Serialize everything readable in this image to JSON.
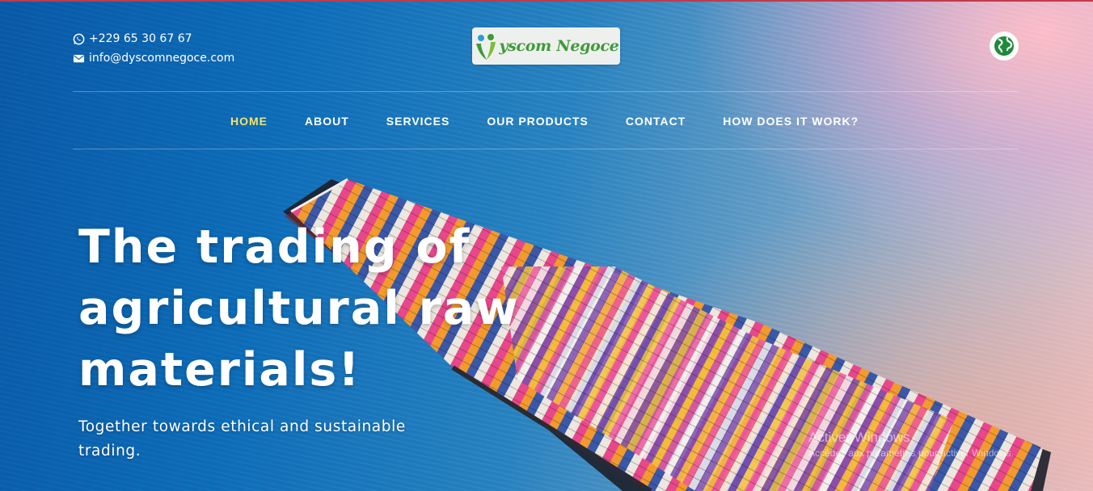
{
  "contact": {
    "phone": "+229 65 30 67 67",
    "email": "info@dyscomnegoce.com",
    "phone_icon": "whatsapp-icon",
    "email_icon": "envelope-icon"
  },
  "logo": {
    "text": "yscom Negoce",
    "brand_color": "#3f9a3a"
  },
  "language_button": {
    "icon": "globe-icon"
  },
  "nav": {
    "items": [
      {
        "label": "HOME",
        "active": true
      },
      {
        "label": "ABOUT",
        "active": false
      },
      {
        "label": "SERVICES",
        "active": false
      },
      {
        "label": "OUR PRODUCTS",
        "active": false
      },
      {
        "label": "CONTACT",
        "active": false
      },
      {
        "label": "HOW DOES IT WORK?",
        "active": false
      }
    ],
    "active_color": "#f5e36a"
  },
  "hero": {
    "headline": "The trading of agricultural raw materials!",
    "subheadline": "Together towards ethical and sustainable trading.",
    "image": "container-ship-at-sea"
  },
  "watermark": {
    "title": "Activer Windows",
    "subtitle": "Accédez aux paramètres pour activer Windows."
  }
}
